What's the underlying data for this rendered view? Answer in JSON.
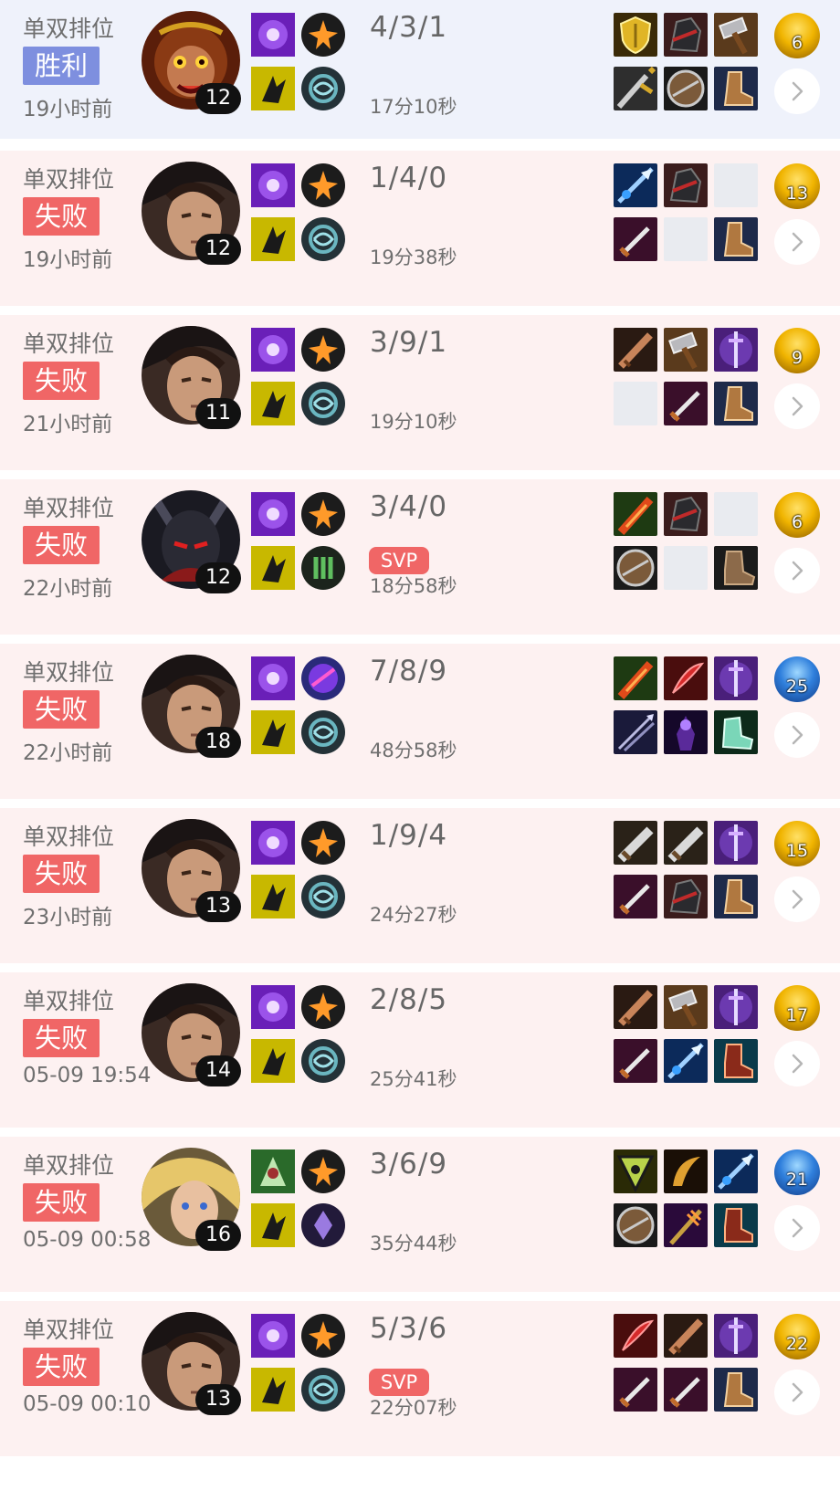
{
  "matches": [
    {
      "mode": "单双排位",
      "result": "胜利",
      "result_type": "win",
      "time": "19小时前",
      "champion": "monkey-king",
      "level": "12",
      "kda": "4/3/1",
      "svp": "",
      "duration": "17分10秒",
      "runes": [
        "violet",
        "yellow"
      ],
      "spells": [
        "flash",
        "cleanse"
      ],
      "items": [
        "gold-shield",
        "dark-helm",
        "hammer",
        "longsword",
        "round-shield",
        "boots"
      ],
      "badge": {
        "value": "6",
        "tone": "gold"
      }
    },
    {
      "mode": "单双排位",
      "result": "失败",
      "result_type": "lose",
      "time": "19小时前",
      "champion": "swordsman",
      "level": "12",
      "kda": "1/4/0",
      "svp": "",
      "duration": "19分38秒",
      "runes": [
        "violet",
        "yellow"
      ],
      "spells": [
        "flash",
        "cleanse"
      ],
      "items": [
        "blue-spear",
        "dark-helm",
        "empty",
        "dagger",
        "empty",
        "boots"
      ],
      "badge": {
        "value": "13",
        "tone": "gold"
      }
    },
    {
      "mode": "单双排位",
      "result": "失败",
      "result_type": "lose",
      "time": "21小时前",
      "champion": "swordsman",
      "level": "11",
      "kda": "3/9/1",
      "svp": "",
      "duration": "19分10秒",
      "runes": [
        "violet",
        "yellow"
      ],
      "spells": [
        "flash",
        "cleanse"
      ],
      "items": [
        "bronze-blade",
        "hammer",
        "violet-sword",
        "empty",
        "dagger",
        "boots"
      ],
      "badge": {
        "value": "9",
        "tone": "gold"
      }
    },
    {
      "mode": "单双排位",
      "result": "失败",
      "result_type": "lose",
      "time": "22小时前",
      "champion": "dark-knight",
      "level": "12",
      "kda": "3/4/0",
      "svp": "SVP",
      "duration": "18分58秒",
      "runes": [
        "violet",
        "yellow"
      ],
      "spells": [
        "flash",
        "green-rune"
      ],
      "items": [
        "fire-blade",
        "dark-helm",
        "empty",
        "round-shield",
        "empty",
        "boots-brown"
      ],
      "badge": {
        "value": "6",
        "tone": "gold"
      }
    },
    {
      "mode": "单双排位",
      "result": "失败",
      "result_type": "lose",
      "time": "22小时前",
      "champion": "swordsman",
      "level": "18",
      "kda": "7/8/9",
      "svp": "",
      "duration": "48分58秒",
      "runes": [
        "violet",
        "yellow"
      ],
      "spells": [
        "purple-orb",
        "cleanse"
      ],
      "items": [
        "fire-blade",
        "red-blade",
        "violet-sword",
        "twin-arrow",
        "shadow",
        "spirit-boot"
      ],
      "badge": {
        "value": "25",
        "tone": "blue"
      }
    },
    {
      "mode": "单双排位",
      "result": "失败",
      "result_type": "lose",
      "time": "23小时前",
      "champion": "swordsman",
      "level": "13",
      "kda": "1/9/4",
      "svp": "",
      "duration": "24分27秒",
      "runes": [
        "violet",
        "yellow"
      ],
      "spells": [
        "flash",
        "cleanse"
      ],
      "items": [
        "steel-blade",
        "steel-blade",
        "violet-sword",
        "dagger",
        "dark-helm",
        "boots"
      ],
      "badge": {
        "value": "15",
        "tone": "gold"
      }
    },
    {
      "mode": "单双排位",
      "result": "失败",
      "result_type": "lose",
      "time": "05-09 19:54",
      "champion": "swordsman",
      "level": "14",
      "kda": "2/8/5",
      "svp": "",
      "duration": "25分41秒",
      "runes": [
        "violet",
        "yellow"
      ],
      "spells": [
        "flash",
        "cleanse"
      ],
      "items": [
        "bronze-blade",
        "hammer",
        "violet-sword",
        "dagger",
        "blue-spear",
        "red-boots"
      ],
      "badge": {
        "value": "17",
        "tone": "gold"
      }
    },
    {
      "mode": "单双排位",
      "result": "失败",
      "result_type": "lose",
      "time": "05-09 00:58",
      "champion": "blonde",
      "level": "16",
      "kda": "3/6/9",
      "svp": "",
      "duration": "35分44秒",
      "runes": [
        "green",
        "yellow"
      ],
      "spells": [
        "flash",
        "violet-crystal"
      ],
      "items": [
        "green-emblem",
        "gold-scythe",
        "blue-spear",
        "round-shield",
        "gold-staff",
        "red-boots"
      ],
      "badge": {
        "value": "21",
        "tone": "blue"
      }
    },
    {
      "mode": "单双排位",
      "result": "失败",
      "result_type": "lose",
      "time": "05-09 00:10",
      "champion": "swordsman",
      "level": "13",
      "kda": "5/3/6",
      "svp": "SVP",
      "duration": "22分07秒",
      "runes": [
        "violet",
        "yellow"
      ],
      "spells": [
        "flash",
        "cleanse"
      ],
      "items": [
        "red-blade",
        "bronze-blade",
        "violet-sword",
        "dagger",
        "dagger",
        "boots"
      ],
      "badge": {
        "value": "22",
        "tone": "gold"
      }
    }
  ]
}
